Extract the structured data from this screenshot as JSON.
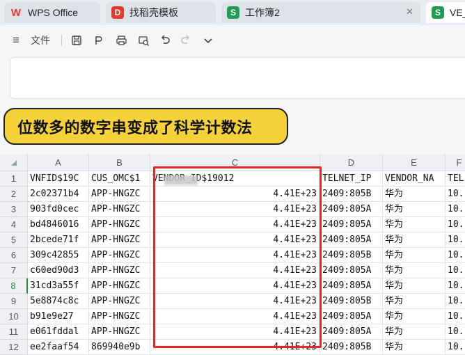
{
  "tabs": [
    {
      "label": "WPS Office",
      "icon": "wps-logo-icon",
      "color": "#e23b2e"
    },
    {
      "label": "找稻壳模板",
      "icon": "docer-icon",
      "color": "#e23b2e"
    },
    {
      "label": "工作簿2",
      "icon": "spreadsheet-s-icon",
      "color": "#1f9d55"
    },
    {
      "label": "VE_",
      "icon": "spreadsheet-s-icon",
      "color": "#1f9d55"
    }
  ],
  "toolbar": {
    "file_label": "文件",
    "icons": [
      "menu-icon",
      "save-icon",
      "export-icon",
      "print-icon",
      "print-preview-icon",
      "undo-icon",
      "redo-icon",
      "more-dropdown-icon"
    ]
  },
  "callout": "位数多的数字串变成了科学计数法",
  "columns": [
    "A",
    "B",
    "C",
    "D",
    "E",
    "F"
  ],
  "rows": [
    {
      "n": "1",
      "a": "VNFID$19C",
      "b": "CUS_OMC$1",
      "c": "VENDOR_ID$19012",
      "d": "TELNET_IP",
      "e": "VENDOR_NA",
      "f": "TEL"
    },
    {
      "n": "2",
      "a": "2c02371b4",
      "b": "APP-HNGZC",
      "c": "4.41E+23",
      "d": "2409:805B",
      "e": "华为",
      "f": "10."
    },
    {
      "n": "3",
      "a": "903fd0cec",
      "b": "APP-HNGZC",
      "c": "4.41E+23",
      "d": "2409:805A",
      "e": "华为",
      "f": "10."
    },
    {
      "n": "4",
      "a": "bd4846016",
      "b": "APP-HNGZC",
      "c": "4.41E+23",
      "d": "2409:805A",
      "e": "华为",
      "f": "10."
    },
    {
      "n": "5",
      "a": "2bcede71f",
      "b": "APP-HNGZC",
      "c": "4.41E+23",
      "d": "2409:805A",
      "e": "华为",
      "f": "10."
    },
    {
      "n": "6",
      "a": "309c42855",
      "b": "APP-HNGZC",
      "c": "4.41E+23",
      "d": "2409:805B",
      "e": "华为",
      "f": "10."
    },
    {
      "n": "7",
      "a": "c60ed90d3",
      "b": "APP-HNGZC",
      "c": "4.41E+23",
      "d": "2409:805A",
      "e": "华为",
      "f": "10."
    },
    {
      "n": "8",
      "a": "31cd3a55f",
      "b": "APP-HNGZC",
      "c": "4.41E+23",
      "d": "2409:805A",
      "e": "华为",
      "f": "10."
    },
    {
      "n": "9",
      "a": "5e8874c8c",
      "b": "APP-HNGZC",
      "c": "4.41E+23",
      "d": "2409:805B",
      "e": "华为",
      "f": "10."
    },
    {
      "n": "10",
      "a": "b91e9e27",
      "b": "APP-HNGZC",
      "c": "4.41E+23",
      "d": "2409:805A",
      "e": "华为",
      "f": "10."
    },
    {
      "n": "11",
      "a": "e061fddal",
      "b": "APP-HNGZC",
      "c": "4.41E+23",
      "d": "2409:805A",
      "e": "华为",
      "f": "10."
    },
    {
      "n": "12",
      "a": "ee2faaf54",
      "b": "869940e9b",
      "c": "4.41E+23",
      "d": "2409:805B",
      "e": "华为",
      "f": "10."
    }
  ],
  "selected_row": "8",
  "colors": {
    "highlight_box": "#e02a2a",
    "callout_bg": "#f6d23a",
    "selected_row_header": "#1e8e3e"
  }
}
